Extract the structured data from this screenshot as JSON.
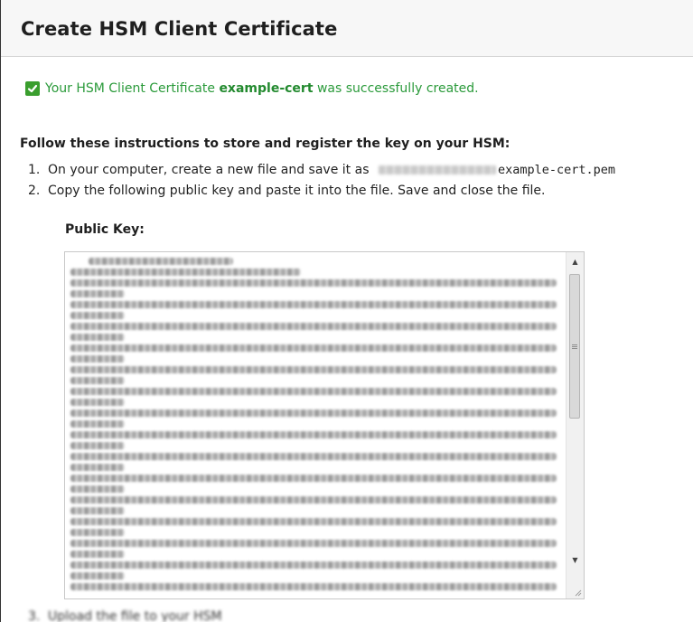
{
  "dialog": {
    "title": "Create HSM Client Certificate"
  },
  "success": {
    "icon": "checkmark-icon",
    "prefix": "Your HSM Client Certificate ",
    "cert_name": "example-cert",
    "suffix": " was successfully created.",
    "color": "#2a9a3a"
  },
  "instructions": {
    "heading": "Follow these instructions to store and register the key on your HSM:",
    "steps": [
      {
        "number": "1.",
        "text": "On your computer, create a new file and save it as ",
        "filename": "example-cert.pem"
      },
      {
        "number": "2.",
        "text": "Copy the following public key and paste it into the file. Save and close the file."
      },
      {
        "number": "3.",
        "text": "Upload the file to your HSM"
      }
    ]
  },
  "public_key": {
    "label": "Public Key:"
  }
}
